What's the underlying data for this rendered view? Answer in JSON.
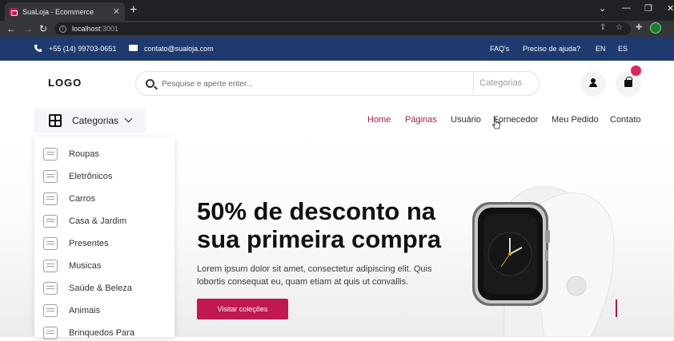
{
  "browser": {
    "tab_title": "SuaLoja - Ecommerce",
    "url_host": "localhost",
    "url_port": ":3001",
    "close_glyph": "✕",
    "new_tab_glyph": "+",
    "back_glyph": "←",
    "forward_glyph": "→",
    "reload_glyph": "↻",
    "info_glyph": "i",
    "share_glyph": "⇪",
    "bookmark_glyph": "☆",
    "extensions_glyph": "✚",
    "minimize_glyph": "—",
    "restore_glyph": "❐",
    "window_close_glyph": "✕",
    "tab_list_glyph": "⌄"
  },
  "topbar": {
    "phone": "+55 (14) 99703-0651",
    "email": "contato@sualoja.com",
    "links": [
      "FAQ's",
      "Preciso de ajuda?",
      "EN",
      "ES"
    ]
  },
  "header": {
    "logo": "LOGO",
    "search_placeholder": "Pesquise e aperte enter...",
    "search_category": "Categorias"
  },
  "nav": {
    "categories_button": "Categorias",
    "items": [
      "Home",
      "Páginas",
      "Usuário",
      "Fornecedor",
      "Meu Pedido",
      "Contato"
    ],
    "active_items": [
      "Home",
      "Páginas"
    ]
  },
  "sidebar": {
    "items": [
      "Roupas",
      "Eletrônicos",
      "Carros",
      "Casa & Jardim",
      "Presentes",
      "Musicas",
      "Saúde & Beleza",
      "Animais",
      "Brinquedos Para"
    ]
  },
  "hero": {
    "headline": "50% de desconto na sua primeira compra",
    "body": "Lorem ipsum dolor sit amet, consectetur adipiscing elit. Quis lobortis consequat eu, quam etiam at quis ut convallis.",
    "cta": "Visitar coleções"
  },
  "colors": {
    "topbar_bg": "#1e3a6e",
    "accent": "#c0184f",
    "nav_active": "#b0174e",
    "badge": "#e0245e"
  }
}
